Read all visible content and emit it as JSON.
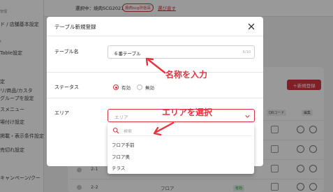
{
  "topbar": {
    "selected_label": "選択中：焼肉SCG2021",
    "badge": "焼肉scg渋谷店",
    "return_link": "選び直す"
  },
  "sidebar": {
    "items": [
      {
        "label": "管理",
        "small": true
      },
      {
        "label": "ド / 店舗基本設定"
      },
      {
        "label": "t",
        "small": true
      },
      {
        "label": "Table設定"
      },
      {
        "label": "定"
      },
      {
        "label": "リ/商品/カスタ"
      },
      {
        "label": "グループを設定"
      },
      {
        "label": "スメニュー"
      },
      {
        "label": "場付け設定"
      },
      {
        "label": "掲載・表示条件設定"
      },
      {
        "label": "売切れ設定"
      },
      {
        "label": "キャンペーン/クー"
      }
    ]
  },
  "main": {
    "new_button": "＋新規登録",
    "col_qr": "QRコード",
    "col_edit": "編集",
    "rows": [
      {
        "id": "2-1"
      },
      {
        "id": "2-2",
        "area": "フロア",
        "status": "有効"
      }
    ]
  },
  "modal": {
    "title": "テーブル新規登録",
    "name_label": "テーブル名",
    "name_value": "６番テーブル",
    "name_count": "6/10",
    "status_label": "ステータス",
    "status_options": [
      "有効",
      "無効"
    ],
    "status_selected": "有効",
    "area_label": "エリア",
    "area_placeholder": "エリア"
  },
  "dropdown": {
    "search_placeholder": "検索",
    "options": [
      "フロア手前",
      "フロア奥",
      "テラス"
    ]
  },
  "annotations": {
    "name_hint": "名称を入力",
    "area_hint": "エリアを選択"
  },
  "colors": {
    "accent": "#d9343f",
    "annotation": "#e8323f"
  }
}
